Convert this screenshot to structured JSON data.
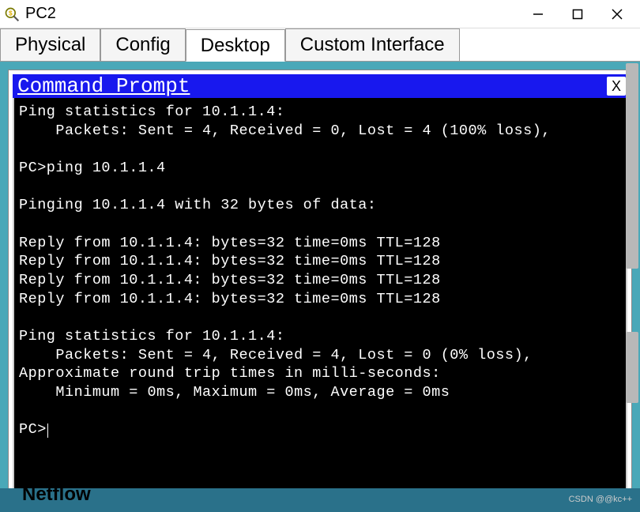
{
  "window": {
    "title": "PC2"
  },
  "tabs": [
    {
      "label": "Physical",
      "active": false
    },
    {
      "label": "Config",
      "active": false
    },
    {
      "label": "Desktop",
      "active": true
    },
    {
      "label": "Custom Interface",
      "active": false
    }
  ],
  "command_prompt": {
    "title": "Command Prompt",
    "close_label": "X",
    "lines": [
      "Ping statistics for 10.1.1.4:",
      "    Packets: Sent = 4, Received = 0, Lost = 4 (100% loss),",
      "",
      "PC>ping 10.1.1.4",
      "",
      "Pinging 10.1.1.4 with 32 bytes of data:",
      "",
      "Reply from 10.1.1.4: bytes=32 time=0ms TTL=128",
      "Reply from 10.1.1.4: bytes=32 time=0ms TTL=128",
      "Reply from 10.1.1.4: bytes=32 time=0ms TTL=128",
      "Reply from 10.1.1.4: bytes=32 time=0ms TTL=128",
      "",
      "Ping statistics for 10.1.1.4:",
      "    Packets: Sent = 4, Received = 4, Lost = 0 (0% loss),",
      "Approximate round trip times in milli-seconds:",
      "    Minimum = 0ms, Maximum = 0ms, Average = 0ms",
      "",
      "PC>"
    ]
  },
  "bottom_strip": {
    "label": "Netflow"
  },
  "watermark": "CSDN @@kc++"
}
